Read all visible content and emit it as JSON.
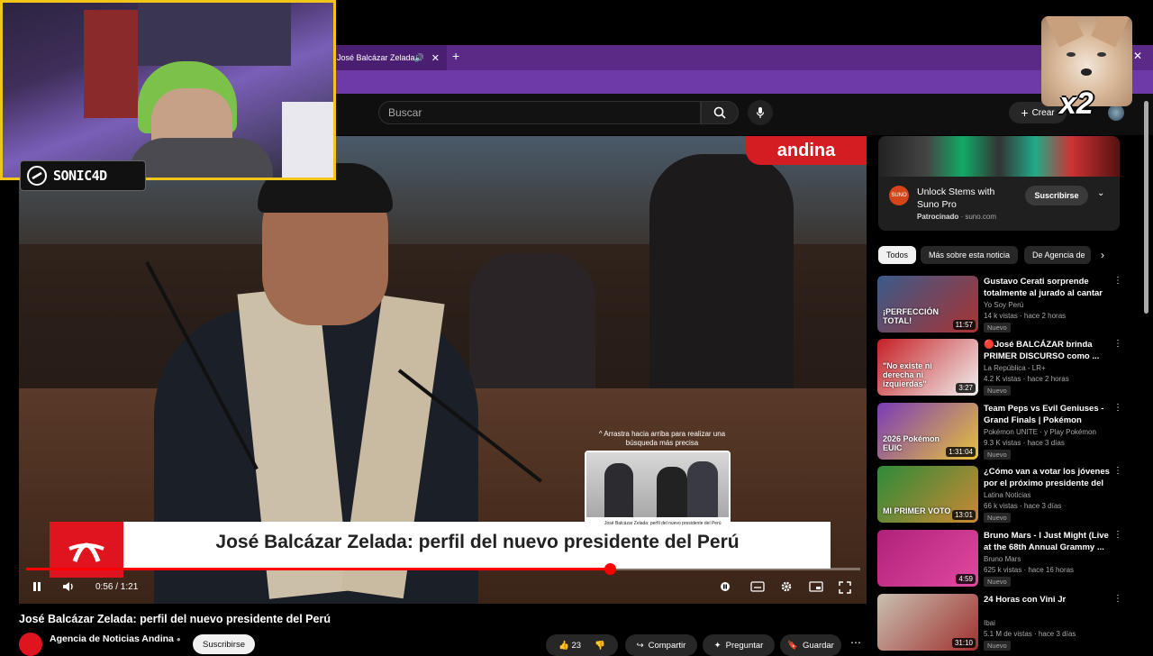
{
  "browser": {
    "tab_title": "José Balcázar Zelada: pe",
    "tab_close": "✕",
    "new_tab": "+",
    "window_close": "✕"
  },
  "header": {
    "search_placeholder": "Buscar",
    "create_label": "Crear"
  },
  "player": {
    "watermark": "andina",
    "lower_third_title": "José Balcázar Zelada: perfil del nuevo presidente del Perú",
    "preview_hint": "^ Arrastra hacia arriba para realizar una búsqueda más precisa",
    "preview_caption": "José Balcázar Zelada: perfil del nuevo presidente del Perú",
    "time": "0:56 / 1:21",
    "progress_fraction": 0.7
  },
  "video": {
    "title": "José Balcázar Zelada: perfil del nuevo presidente del Perú",
    "channel": "Agencia de Noticias Andina",
    "subscribe": "Suscribirse",
    "likes": "23",
    "share": "Compartir",
    "ask": "Preguntar",
    "save": "Guardar"
  },
  "ad": {
    "logo_text": "SUNO",
    "title": "Unlock Stems with Suno Pro",
    "sponsor_label": "Patrocinado",
    "sponsor_domain": "suno.com",
    "subscribe": "Suscribirse"
  },
  "chips": [
    "Todos",
    "Más sobre esta noticia",
    "De Agencia de"
  ],
  "recommendations": [
    {
      "title": "Gustavo Cerati sorprende totalmente al jurado al cantar ...",
      "channel": "Yo Soy Perú",
      "meta": "14 k vistas · hace 2 horas",
      "badge": "Nuevo",
      "duration": "11:57",
      "thumb_text": "¡PERFECCIÓN TOTAL!",
      "color_a": "#3a5a8a",
      "color_b": "#a33"
    },
    {
      "title": "🔴José BALCÁZAR brinda PRIMER DISCURSO como ...",
      "channel": "La República - LR+",
      "meta": "4.2 K vistas · hace 2 horas",
      "badge": "Nuevo",
      "duration": "3:27",
      "thumb_text": "\"No existe ni derecha ni izquierdas\"",
      "color_a": "#c51f24",
      "color_b": "#f2f2f2"
    },
    {
      "title": "Team Peps vs Evil Geniuses - Grand Finals | Pokémon UNITE...",
      "channel": "Pokémon UNITE · y Play Pokémon",
      "meta": "9.3 K vistas · hace 3 días",
      "badge": "Nuevo",
      "duration": "1:31:04",
      "thumb_text": "2026 Pokémon EUIC",
      "color_a": "#7a3bb8",
      "color_b": "#e8c23a"
    },
    {
      "title": "¿Cómo van a votar los jóvenes por el próximo presidente del ...",
      "channel": "Latina Noticias",
      "meta": "66 k vistas · hace 3 días",
      "badge": "Nuevo",
      "duration": "13:01",
      "thumb_text": "MI PRIMER VOTO",
      "color_a": "#2d8a3a",
      "color_b": "#c83"
    },
    {
      "title": "Bruno Mars - I Just Might (Live at the 68th Annual Grammy ...",
      "channel": "Bruno Mars",
      "meta": "625 k vistas · hace 16 horas",
      "badge": "Nuevo",
      "duration": "4:59",
      "thumb_text": "",
      "color_a": "#b0207a",
      "color_b": "#e04aa0"
    },
    {
      "title": "24 Horas con Vini Jr",
      "channel": "Ibai",
      "meta": "5.1 M de vistas · hace 3 días",
      "badge": "Nuevo",
      "duration": "31:10",
      "thumb_text": "",
      "color_a": "#c9c0b0",
      "color_b": "#a03030"
    }
  ],
  "overlays": {
    "streamer_name": "SONIC4D",
    "speed": "x2"
  }
}
